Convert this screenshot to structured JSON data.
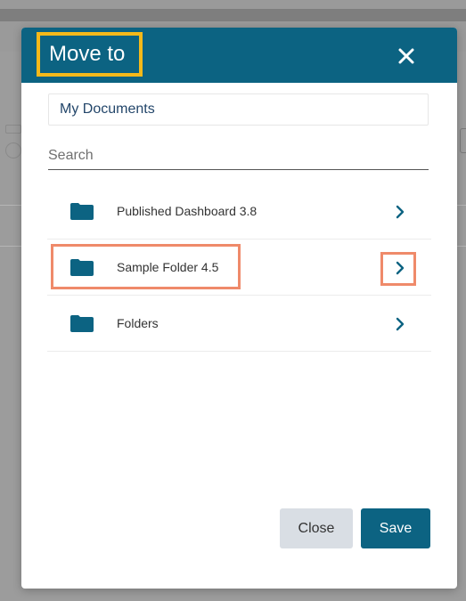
{
  "dialog": {
    "title": "Move to",
    "current_location": "My Documents",
    "search": {
      "placeholder": "Search",
      "value": ""
    },
    "folders": [
      {
        "label": "Published Dashboard 3.8",
        "icon": "folder-icon",
        "chevron": "chevron-right-icon"
      },
      {
        "label": "Sample Folder 4.5",
        "icon": "folder-icon",
        "chevron": "chevron-right-icon",
        "highlighted": true
      },
      {
        "label": "Folders",
        "icon": "folder-icon",
        "chevron": "chevron-right-icon"
      }
    ],
    "close_button": "Close",
    "save_button": "Save",
    "close_icon": "close-icon"
  },
  "colors": {
    "header": "#0c6382",
    "title_highlight": "#f5b91a",
    "annotation": "#ef8a6a",
    "folder_icon": "#0c6382",
    "close_button_bg": "#d9dee4",
    "save_button_bg": "#0c6382"
  }
}
